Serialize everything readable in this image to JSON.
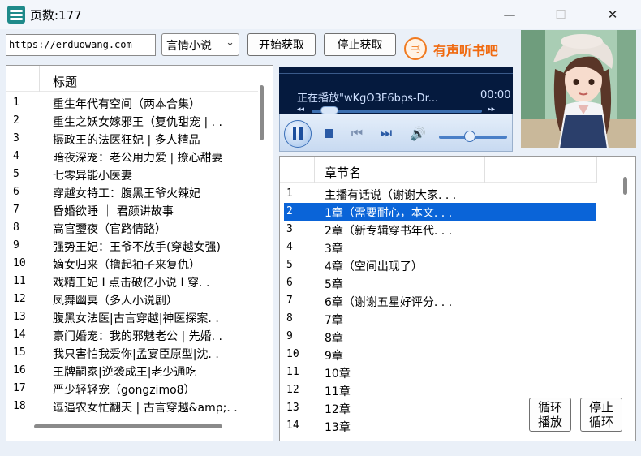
{
  "window": {
    "title": "页数:177",
    "minimize": "—",
    "maximize": "☐",
    "close": "✕"
  },
  "toolbar": {
    "url": "https://erduowang.com",
    "genre": "言情小说",
    "start_label": "开始获取",
    "stop_label": "停止获取",
    "logo_char": "书",
    "logo_text": "有声听书吧"
  },
  "book_list": {
    "header": "标题",
    "rows": [
      {
        "num": "1",
        "title": "重生年代有空间（两本合集）"
      },
      {
        "num": "2",
        "title": "重生之妖女嫁邪王（复仇甜宠 | . ."
      },
      {
        "num": "3",
        "title": "摄政王的法医狂妃 | 多人精品"
      },
      {
        "num": "4",
        "title": "暗夜深宠：老公用力爱 | 撩心甜妻"
      },
      {
        "num": "5",
        "title": "七零异能小医妻"
      },
      {
        "num": "6",
        "title": "穿越女特工：腹黑王爷火辣妃"
      },
      {
        "num": "7",
        "title": "昏婚欲睡 ｜ 君颜讲故事"
      },
      {
        "num": "8",
        "title": "高官瓕夜（官路情路）"
      },
      {
        "num": "9",
        "title": "强势王妃：王爷不放手(穿越女强)"
      },
      {
        "num": "10",
        "title": "嫡女归来（撸起袖子来复仇）"
      },
      {
        "num": "11",
        "title": "戏精王妃 I 点击破亿小说 I 穿. ."
      },
      {
        "num": "12",
        "title": "凤舞幽冥（多人小说剧）"
      },
      {
        "num": "13",
        "title": "腹黑女法医|古言穿越|神医探案. ."
      },
      {
        "num": "14",
        "title": "豪门婚宠：我的邪魅老公 | 先婚. ."
      },
      {
        "num": "15",
        "title": "我只害怕我爱你|孟宴臣原型|沈. ."
      },
      {
        "num": "16",
        "title": "王牌嗣家|逆袭成王|老少通吃"
      },
      {
        "num": "17",
        "title": "严少轻轻宠（gongzimo8）"
      },
      {
        "num": "18",
        "title": "逗逼农女忙翻天 | 古言穿越&amp;. ."
      }
    ]
  },
  "player": {
    "now_playing": "正在播放\"wKgO3F6bps-Dr...",
    "time": "00:00",
    "progress": 0.05,
    "volume": 0.45
  },
  "chapter_list": {
    "header": "章节名",
    "selected_index": 1,
    "rows": [
      {
        "num": "1",
        "title": "主播有话说（谢谢大家. . ."
      },
      {
        "num": "2",
        "title": "1章（需要耐心，本文. . ."
      },
      {
        "num": "3",
        "title": "2章（新专辑穿书年代. . ."
      },
      {
        "num": "4",
        "title": "3章"
      },
      {
        "num": "5",
        "title": "4章（空间出现了）"
      },
      {
        "num": "6",
        "title": "5章"
      },
      {
        "num": "7",
        "title": "6章（谢谢五星好评分. . ."
      },
      {
        "num": "8",
        "title": "7章"
      },
      {
        "num": "9",
        "title": "8章"
      },
      {
        "num": "10",
        "title": "9章"
      },
      {
        "num": "11",
        "title": "10章"
      },
      {
        "num": "12",
        "title": "11章"
      },
      {
        "num": "13",
        "title": "12章"
      },
      {
        "num": "14",
        "title": "13章"
      }
    ]
  },
  "loop_buttons": {
    "loop_play_l1": "循环",
    "loop_play_l2": "播放",
    "stop_loop_l1": "停止",
    "stop_loop_l2": "循环"
  }
}
